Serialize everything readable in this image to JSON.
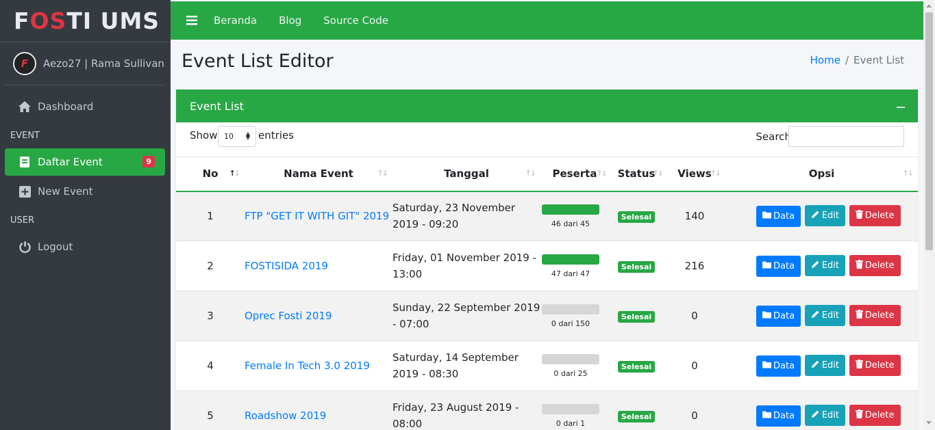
{
  "brand": {
    "part1": "F",
    "part2": "OS",
    "part3": "TI UMS",
    "logo_letter": "F"
  },
  "user": {
    "name": "Aezo27 | Rama Sullivan"
  },
  "sidebar": {
    "dashboard": "Dashboard",
    "event_header": "EVENT",
    "daftar_event": "Daftar Event",
    "daftar_event_badge": "9",
    "new_event": "New Event",
    "user_header": "USER",
    "logout": "Logout"
  },
  "topnav": {
    "beranda": "Beranda",
    "blog": "Blog",
    "source_code": "Source Code"
  },
  "page": {
    "title": "Event List Editor"
  },
  "breadcrumb": {
    "home": "Home",
    "sep": "/",
    "current": "Event List"
  },
  "card": {
    "title": "Event List"
  },
  "controls": {
    "show": "Show",
    "entries_value": "10",
    "entries": "entries",
    "search": "Search:"
  },
  "table": {
    "headers": {
      "no": "No",
      "name": "Nama Event",
      "date": "Tanggal",
      "peserta": "Peserta",
      "status": "Status",
      "views": "Views",
      "opsi": "Opsi"
    },
    "buttons": {
      "data": "Data",
      "edit": "Edit",
      "delete": "Delete"
    },
    "rows": [
      {
        "no": "1",
        "name": "FTP \"GET IT WITH GIT\" 2019",
        "date": "Saturday, 23 November 2019 - 09:20",
        "peserta": "46 dari 45",
        "fill": 1.0,
        "status": "Selesai",
        "views": "140"
      },
      {
        "no": "2",
        "name": "FOSTISIDA 2019",
        "date": "Friday, 01 November 2019 - 13:00",
        "peserta": "47 dari 47",
        "fill": 1.0,
        "status": "Selesai",
        "views": "216"
      },
      {
        "no": "3",
        "name": "Oprec Fosti 2019",
        "date": "Sunday, 22 September 2019 - 07:00",
        "peserta": "0 dari 150",
        "fill": 0,
        "status": "Selesai",
        "views": "0"
      },
      {
        "no": "4",
        "name": "Female In Tech 3.0 2019",
        "date": "Saturday, 14 September 2019 - 08:30",
        "peserta": "0 dari 25",
        "fill": 0,
        "status": "Selesai",
        "views": "0"
      },
      {
        "no": "5",
        "name": "Roadshow 2019",
        "date": "Friday, 23 August 2019 - 08:00",
        "peserta": "0 dari 1",
        "fill": 0,
        "status": "Selesai",
        "views": "0"
      }
    ]
  },
  "colors": {
    "primary_green": "#28a745",
    "sidebar_bg": "#343a40",
    "brand_red": "#dc3545"
  }
}
